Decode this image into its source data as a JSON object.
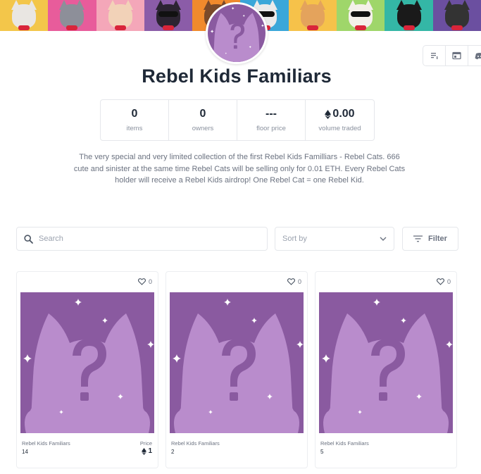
{
  "collection": {
    "name": "Rebel Kids Familiars",
    "description": "The very special and very limited collection of the first Rebel Kids Familiars - Rebel Cats. 666 cute and sinister at the same time Rebel Cats will be selling only for 0.01 ETH. Every Rebel Cats holder will receive a Rebel Kids airdrop! One Rebel Cat = one Rebel Kid.",
    "description_lines": [
      "The very special and very limited collection of the first Rebel Kids Familliars - Rebel Cats. 666",
      "cute and sinister at the same time Rebel Cats will be selling only for 0.01 ETH. Every Rebel Cats",
      "holder will receive a Rebel Kids airdrop! One Rebel Cat = one Rebel Kid."
    ]
  },
  "banner": {
    "tiles": [
      {
        "bg": "#f3c64a",
        "cat": "#e9e6e2",
        "mask": false
      },
      {
        "bg": "#e85c9b",
        "cat": "#8d8f99",
        "mask": false
      },
      {
        "bg": "#f4a7b9",
        "cat": "#f2d2b8",
        "mask": false
      },
      {
        "bg": "#8b5ca8",
        "cat": "#2c2432",
        "mask": true
      },
      {
        "bg": "#f08a2c",
        "cat": "#7a4a2a",
        "mask": false
      },
      {
        "bg": "#3aa7d9",
        "cat": "#eaeaea",
        "mask": true
      },
      {
        "bg": "#f6c24a",
        "cat": "#e4a35c",
        "mask": false
      },
      {
        "bg": "#9fd66a",
        "cat": "#f4f0ea",
        "mask": true
      },
      {
        "bg": "#34b7a6",
        "cat": "#1a1a1a",
        "mask": false
      },
      {
        "bg": "#6b4fa0",
        "cat": "#333333",
        "mask": false
      }
    ]
  },
  "toolbar": {
    "icons": [
      "list-icon",
      "window-icon",
      "discord-icon"
    ]
  },
  "stats": [
    {
      "value": "0",
      "label": "items",
      "eth": false
    },
    {
      "value": "0",
      "label": "owners",
      "eth": false
    },
    {
      "value": "---",
      "label": "floor price",
      "eth": false
    },
    {
      "value": "0.00",
      "label": "volume traded",
      "eth": true
    }
  ],
  "controls": {
    "search_placeholder": "Search",
    "sort_placeholder": "Sort by",
    "filter_label": "Filter"
  },
  "cards": [
    {
      "likes": "0",
      "collection": "Rebel Kids Familiars",
      "token": "14",
      "price_label": "Price",
      "price": "1"
    },
    {
      "likes": "0",
      "collection": "Rebel Kids Familiars",
      "token": "2",
      "price_label": "",
      "price": ""
    },
    {
      "likes": "0",
      "collection": "Rebel Kids Familiars",
      "token": "5",
      "price_label": "",
      "price": ""
    }
  ],
  "colors": {
    "placeholder_bg": "#8a5aa0",
    "placeholder_fg": "#b98ccc",
    "text_dark": "#1f2937",
    "text_muted": "#6b7280",
    "border": "#e5e7eb"
  }
}
